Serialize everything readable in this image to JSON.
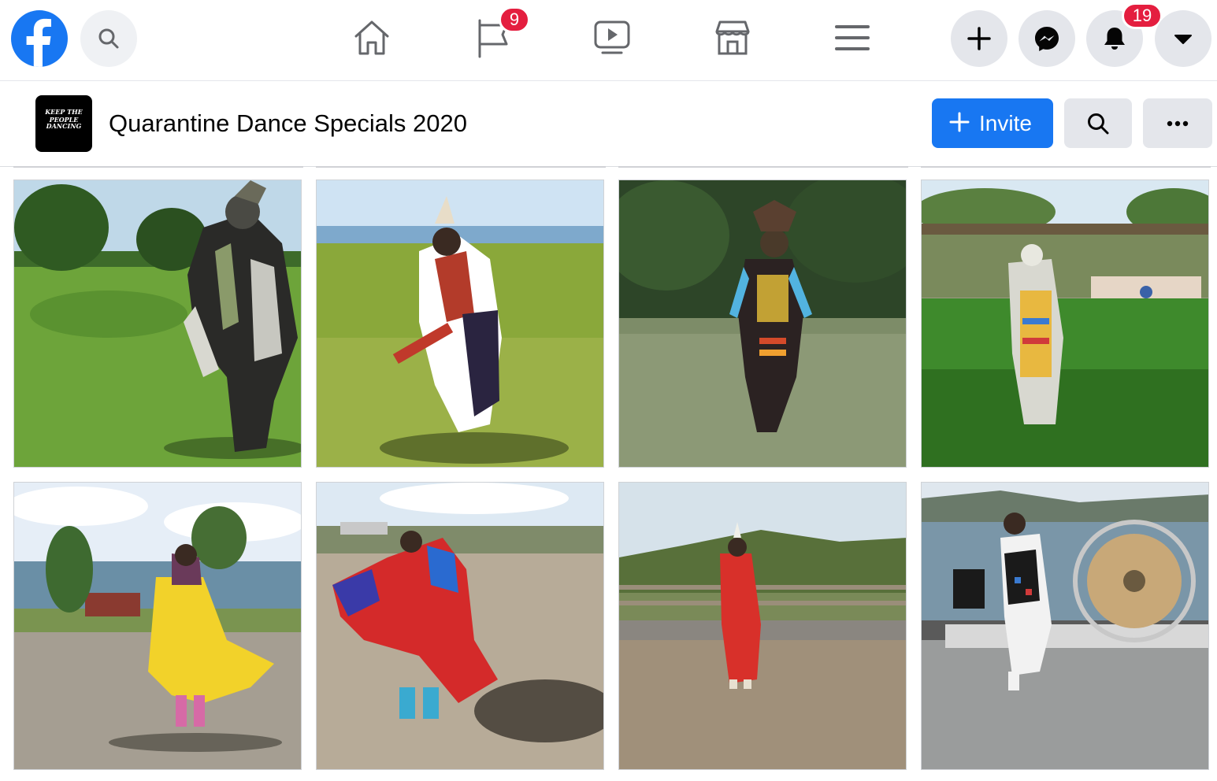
{
  "nav": {
    "logo_icon": "facebook-logo-icon",
    "notifications_pages_badge": "9",
    "notifications_badge": "19",
    "icons": [
      "home-icon",
      "pages-flag-icon",
      "watch-icon",
      "marketplace-icon",
      "menu-icon",
      "plus-icon",
      "messenger-icon",
      "bell-icon",
      "caret-down-icon"
    ]
  },
  "group": {
    "avatar_line1": "KEEP THE PEOPLE",
    "avatar_line2": "DANCING",
    "title": "Quarantine Dance Specials 2020",
    "invite_label": "Invite"
  },
  "grid": {
    "tiles": [
      {
        "scene": "park"
      },
      {
        "scene": "lake-field"
      },
      {
        "scene": "trees-field"
      },
      {
        "scene": "arena"
      },
      {
        "scene": "lakeside-yellow"
      },
      {
        "scene": "lot-red"
      },
      {
        "scene": "fence-hills"
      },
      {
        "scene": "airboat"
      }
    ]
  },
  "colors": {
    "brand": "#1877f2",
    "badge": "#e41e3f",
    "button_gray": "#e4e6eb"
  }
}
